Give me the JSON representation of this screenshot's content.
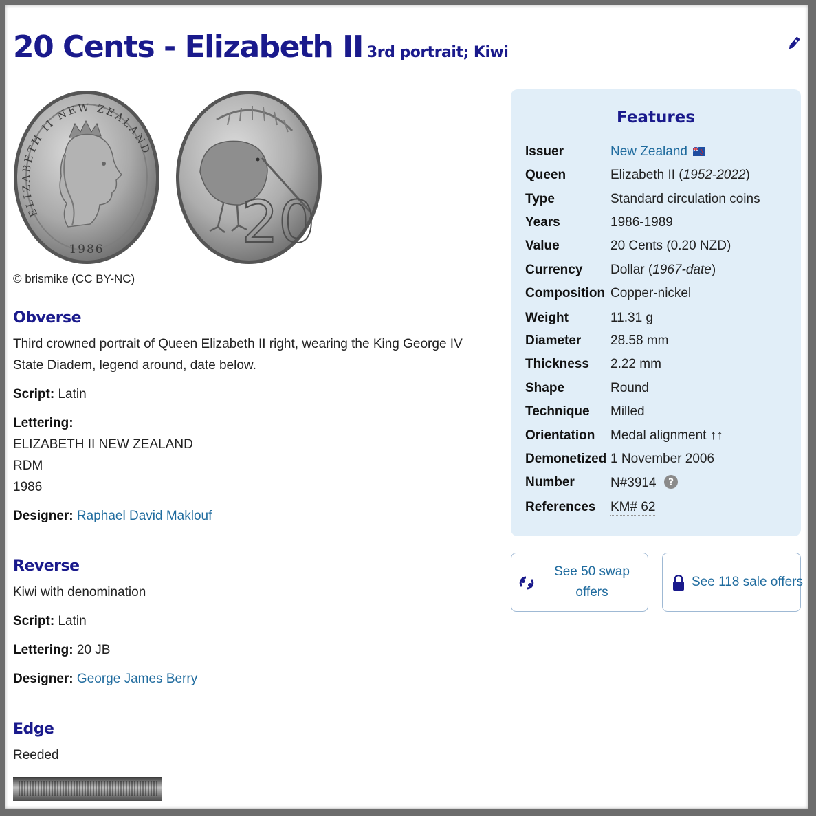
{
  "title": {
    "main": "20 Cents - Elizabeth II",
    "sub": "3rd portrait; Kiwi"
  },
  "credit": "© brismike (CC BY-NC)",
  "coin_obverse": {
    "legend": "ELIZABETH II NEW ZEALAND",
    "date": "1986"
  },
  "coin_reverse": {
    "denomination": "20"
  },
  "obverse": {
    "heading": "Obverse",
    "description": "Third crowned portrait of Queen Elizabeth II right, wearing the King George IV State Diadem, legend around, date below.",
    "script_label": "Script:",
    "script": "Latin",
    "lettering_label": "Lettering:",
    "lettering": [
      "ELIZABETH II NEW ZEALAND",
      "RDM",
      "1986"
    ],
    "designer_label": "Designer:",
    "designer": "Raphael David Maklouf"
  },
  "reverse": {
    "heading": "Reverse",
    "description": "Kiwi with denomination",
    "script_label": "Script:",
    "script": "Latin",
    "lettering_label": "Lettering:",
    "lettering": "20 JB",
    "designer_label": "Designer:",
    "designer": "George James Berry"
  },
  "edge": {
    "heading": "Edge",
    "description": "Reeded"
  },
  "features": {
    "heading": "Features",
    "issuer": {
      "label": "Issuer",
      "value": "New Zealand"
    },
    "queen": {
      "label": "Queen",
      "value": "Elizabeth II (",
      "years": "1952-2022",
      "close": ")"
    },
    "type": {
      "label": "Type",
      "value": "Standard circulation coins"
    },
    "years": {
      "label": "Years",
      "value": "1986-1989"
    },
    "value": {
      "label": "Value",
      "value": "20 Cents (0.20 NZD)"
    },
    "currency": {
      "label": "Currency",
      "value": "Dollar (",
      "years": "1967-date",
      "close": ")"
    },
    "composition": {
      "label": "Composition",
      "value": "Copper-nickel"
    },
    "weight": {
      "label": "Weight",
      "value": "11.31 g"
    },
    "diameter": {
      "label": "Diameter",
      "value": "28.58 mm"
    },
    "thickness": {
      "label": "Thickness",
      "value": "2.22 mm"
    },
    "shape": {
      "label": "Shape",
      "value": "Round"
    },
    "technique": {
      "label": "Technique",
      "value": "Milled"
    },
    "orientation": {
      "label": "Orientation",
      "value": "Medal alignment ↑↑"
    },
    "demonetized": {
      "label": "Demonetized",
      "value": "1 November 2006"
    },
    "number": {
      "label": "Number",
      "value": "N#3914"
    },
    "references": {
      "label": "References",
      "value": "KM# 62"
    }
  },
  "buttons": {
    "swap": "See 50 swap offers",
    "sale": "See 118 sale offers"
  },
  "colors": {
    "heading": "#1a1a8c",
    "link": "#1f6b9e",
    "queen_link": "#7a2fa8",
    "features_bg": "#e1eef8"
  }
}
